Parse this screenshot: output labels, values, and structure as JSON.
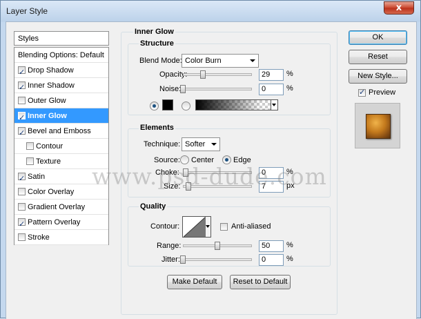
{
  "window": {
    "title": "Layer Style",
    "close_glyph": "x"
  },
  "styles_panel": {
    "header": "Styles",
    "blending": "Blending Options: Default",
    "items": [
      {
        "label": "Drop Shadow",
        "checked": true
      },
      {
        "label": "Inner Shadow",
        "checked": true
      },
      {
        "label": "Outer Glow",
        "checked": false
      },
      {
        "label": "Inner Glow",
        "checked": true,
        "selected": true
      },
      {
        "label": "Bevel and Emboss",
        "checked": true
      },
      {
        "label": "Contour",
        "checked": false,
        "sub": true
      },
      {
        "label": "Texture",
        "checked": false,
        "sub": true
      },
      {
        "label": "Satin",
        "checked": true
      },
      {
        "label": "Color Overlay",
        "checked": false
      },
      {
        "label": "Gradient Overlay",
        "checked": false
      },
      {
        "label": "Pattern Overlay",
        "checked": true
      },
      {
        "label": "Stroke",
        "checked": false
      }
    ]
  },
  "inner_glow": {
    "title": "Inner Glow",
    "structure": {
      "title": "Structure",
      "blend_mode_label": "Blend Mode:",
      "blend_mode_value": "Color Burn",
      "opacity_label": "Opacity:",
      "opacity_value": "29",
      "opacity_unit": "%",
      "opacity_level": 0.29,
      "noise_label": "Noise:",
      "noise_value": "0",
      "noise_unit": "%",
      "noise_level": 0.0,
      "color": "#000000"
    },
    "elements": {
      "title": "Elements",
      "technique_label": "Technique:",
      "technique_value": "Softer",
      "source_label": "Source:",
      "center_label": "Center",
      "edge_label": "Edge",
      "choke_label": "Choke:",
      "choke_value": "0",
      "choke_unit": "%",
      "size_label": "Size:",
      "size_value": "7",
      "size_unit": "px"
    },
    "quality": {
      "title": "Quality",
      "contour_label": "Contour:",
      "anti_aliased_label": "Anti-aliased",
      "range_label": "Range:",
      "range_value": "50",
      "range_unit": "%",
      "range_level": 0.5,
      "jitter_label": "Jitter:",
      "jitter_value": "0",
      "jitter_unit": "%",
      "jitter_level": 0.0
    },
    "make_default_label": "Make Default",
    "reset_default_label": "Reset to Default"
  },
  "buttons": {
    "ok": "OK",
    "reset": "Reset",
    "new_style": "New Style...",
    "preview_label": "Preview"
  },
  "watermark": "www.psd-dude.com"
}
